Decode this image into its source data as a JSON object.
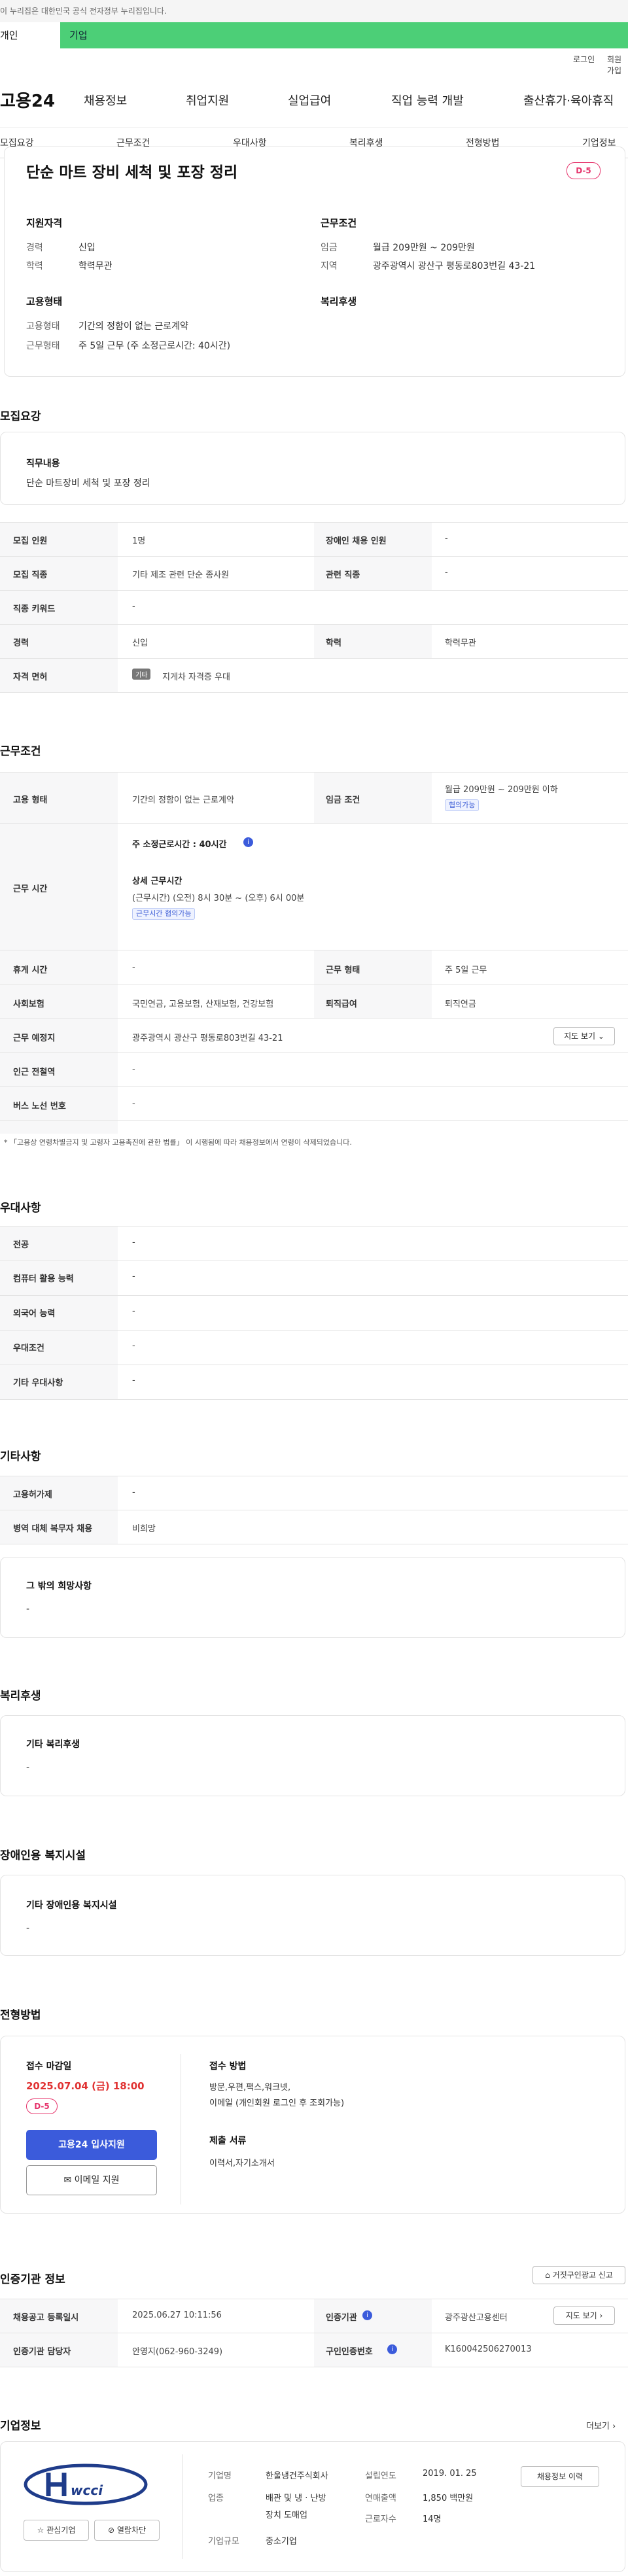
{
  "gov_banner": "이 누리집은 대한민국 공식 전자정부 누리집입니다.",
  "top_tabs": [
    "개인",
    "기업"
  ],
  "util_links": [
    "로그인",
    "회원가입"
  ],
  "gnb": {
    "logo": "고용24",
    "items": [
      "채용정보",
      "취업지원",
      "실업급여",
      "직업 능력 개발",
      "출산휴가·육아휴직"
    ]
  },
  "subnav": [
    "모집요강",
    "근무조건",
    "우대사항",
    "복리후생",
    "전형방법",
    "기업정보"
  ],
  "job": {
    "title": "단순 마트 장비 세척 및 포장 정리",
    "dday": "D-5"
  },
  "summary": {
    "qual_title": "지원자격",
    "career_lbl": "경력",
    "career": "신입",
    "edu_lbl": "학력",
    "edu": "학력무관",
    "cond_title": "근무조건",
    "wage_lbl": "임금",
    "wage": "월급 209만원 ~ 209만원",
    "area_lbl": "지역",
    "area": "광주광역시 광산구 평동로803번길 43-21",
    "emp_title": "고용형태",
    "emp_lbl": "고용형태",
    "emp": "기간의 정함이 없는 근로계약",
    "work_lbl": "근무형태",
    "work": "주 5일 근무 (주 소정근로시간: 40시간)",
    "welfare_title": "복리후생"
  },
  "recruit": {
    "title": "모집요강",
    "duty_lbl": "직무내용",
    "duty": "단순 마트장비 세척 및 포장 정리",
    "rows": [
      {
        "k1": "모집 인원",
        "v1": "1명",
        "k2": "장애인 채용 인원",
        "v2": "-"
      },
      {
        "k1": "모집 직종",
        "v1": "기타 제조 관련 단순 종사원",
        "k2": "관련 직종",
        "v2": "-"
      },
      {
        "k1": "직종 키워드",
        "v1": "-"
      },
      {
        "k1": "경력",
        "v1": "신입",
        "k2": "학력",
        "v2": "학력무관"
      },
      {
        "k1": "자격 면허",
        "tag": "기타",
        "v1": "지게차 자격증 우대"
      }
    ]
  },
  "conditions": {
    "title": "근무조건",
    "emp_k": "고용 형태",
    "emp_v": "기간의 정함이 없는 근로계약",
    "wage_k": "임금 조건",
    "wage_v": "월급 209만원 ~ 209만원 이하",
    "wage_tag": "협의가능",
    "hours_k": "근무 시간",
    "hours_main": "주 소정근로시간 : 40시간",
    "hours_sub_title": "상세 근무시간",
    "hours_sub": "(근무시간) (오전) 8시 30분 ~ (오후) 6시 00분",
    "hours_tag": "근무시간 협의가능",
    "rest_k": "휴게 시간",
    "rest_v": "-",
    "form_k": "근무 형태",
    "form_v": "주 5일 근무",
    "ins_k": "사회보험",
    "ins_v": "국민연금, 고용보험, 산재보험, 건강보험",
    "ret_k": "퇴직급여",
    "ret_v": "퇴직연금",
    "place_k": "근무 예정지",
    "place_v": "광주광역시 광산구 평동로803번길 43-21",
    "map_btn": "지도 보기",
    "subway_k": "인근 전철역",
    "subway_v": "-",
    "bus_k": "버스 노선 번호",
    "bus_v": "-",
    "note": "* 「고용상 연령차별금지 및 고령자 고용촉진에 관한 법률」 이 시행됨에 따라 채용정보에서 연령이 삭제되었습니다."
  },
  "prefer": {
    "title": "우대사항",
    "rows": [
      {
        "k": "전공",
        "v": "-"
      },
      {
        "k": "컴퓨터 활용 능력",
        "v": "-"
      },
      {
        "k": "외국어 능력",
        "v": "-"
      },
      {
        "k": "우대조건",
        "v": "-"
      },
      {
        "k": "기타 우대사항",
        "v": "-"
      }
    ]
  },
  "etc": {
    "title": "기타사항",
    "rows": [
      {
        "k": "고용허가제",
        "v": "-"
      },
      {
        "k": "병역 대체 복무자 채용",
        "v": "비희망"
      }
    ],
    "other_lbl": "그 밖의 희망사항",
    "other": "-"
  },
  "welfare": {
    "title": "복리후생",
    "lbl": "기타 복리후생",
    "v": "-"
  },
  "disabled": {
    "title": "장애인용 복지시설",
    "lbl": "기타 장애인용 복지시설",
    "v": "-"
  },
  "process": {
    "title": "전형방법",
    "deadline_lbl": "접수 마감일",
    "deadline": "2025.07.04 (금) 18:00",
    "dday": "D-5",
    "apply_btn": "고용24 입사지원",
    "email_btn": "이메일 지원",
    "method_lbl": "접수 방법",
    "method1": "방문,우편,팩스,워크넷,",
    "method2": "이메일 (개인회원 로그인 후 조회가능)",
    "docs_lbl": "제출 서류",
    "docs": "이력서,자기소개서"
  },
  "agency": {
    "title": "인증기관 정보",
    "report_btn": "거짓구인광고 신고",
    "reg_k": "채용공고 등록일시",
    "reg_v": "2025.06.27 10:11:56",
    "agency_k": "인증기관",
    "agency_v": "광주광산고용센터",
    "map_btn": "지도 보기",
    "mgr_k": "인증기관 담당자",
    "mgr_v": "안영지(062-960-3249)",
    "cert_k": "구인인증번호",
    "cert_v": "K160042506270013"
  },
  "company": {
    "title": "기업정보",
    "more": "더보기",
    "logo_text": "wcci",
    "fav_btn": "관심기업",
    "block_btn": "열람차단",
    "name_k": "기업명",
    "name_v": "한울냉건주식회사",
    "ind_k": "업종",
    "ind_v1": "배관 및 냉 · 난방",
    "ind_v2": "장치 도매업",
    "size_k": "기업규모",
    "size_v": "중소기업",
    "year_k": "설립연도",
    "year_v": "2019. 01. 25",
    "sales_k": "연매출액",
    "sales_v": "1,850 백만원",
    "emp_k": "근로자수",
    "emp_v": "14명",
    "history_btn": "채용정보 이력"
  },
  "colors": {
    "accent": "#4ccf77",
    "brand_blue": "#3b5bdb",
    "dday": "#e6336b",
    "deadline": "#e03131"
  }
}
